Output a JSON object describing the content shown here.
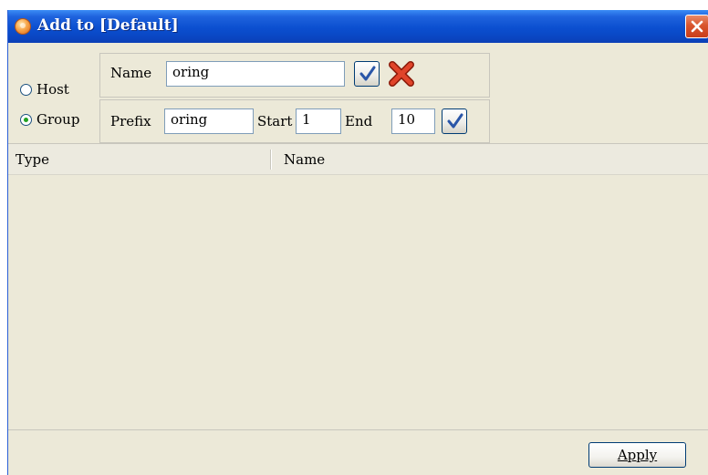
{
  "window": {
    "title": "Add to [Default]"
  },
  "mode": {
    "options": [
      {
        "label": "Host",
        "selected": false
      },
      {
        "label": "Group",
        "selected": true
      }
    ]
  },
  "host_row": {
    "name_label": "Name",
    "name_value": "oring"
  },
  "group_row": {
    "prefix_label": "Prefix",
    "prefix_value": "oring",
    "start_label": "Start",
    "start_value": "1",
    "end_label": "End",
    "end_value": "10"
  },
  "table": {
    "columns": [
      "Type",
      "Name"
    ],
    "rows": []
  },
  "footer": {
    "apply_label": "Apply"
  },
  "icons": {
    "title": "app-logo-icon",
    "close": "close-icon",
    "confirm": "checkmark-icon",
    "delete": "red-x-icon"
  },
  "colors": {
    "titlebar": "#0b4fd0",
    "check": "#2a56a8",
    "delete": "#d33a1a",
    "radio_dot": "#21a121"
  }
}
